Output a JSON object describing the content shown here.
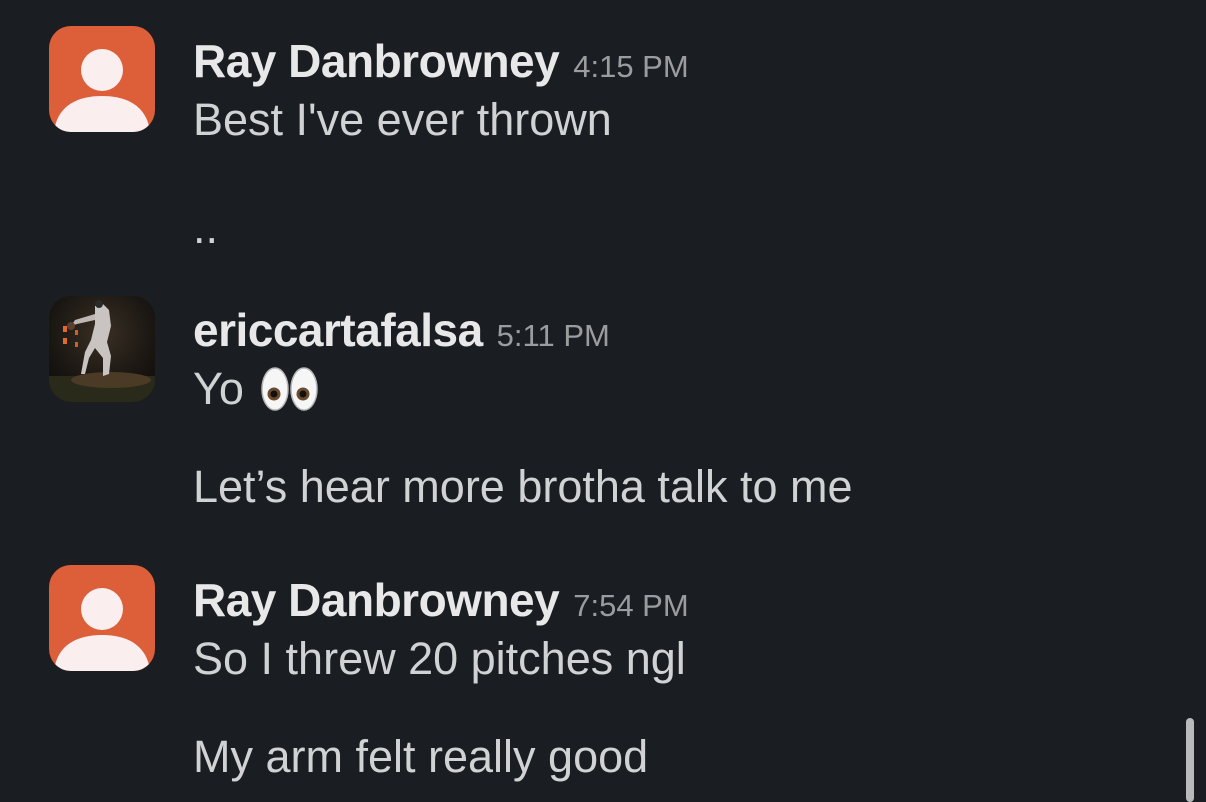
{
  "messages": [
    {
      "author": "Ray Danbrowney",
      "time": "4:15 PM",
      "avatar": "default-user-icon",
      "lines": [
        "Best I've ever thrown",
        ".."
      ]
    },
    {
      "author": "ericcartafalsa",
      "time": "5:11 PM",
      "avatar": "baseball-pitcher-photo",
      "lines": [
        "Yo",
        "Let’s hear more brotha talk to me"
      ],
      "emoji": "eyes-emoji"
    },
    {
      "author": "Ray Danbrowney",
      "time": "7:54 PM",
      "avatar": "default-user-icon",
      "lines": [
        "So I threw 20 pitches ngl",
        "My arm felt really good"
      ]
    }
  ],
  "colors": {
    "background": "#1a1d21",
    "default_avatar": "#dd5f3a",
    "text": "#d1d2d3",
    "timestamp": "#9b9c9e"
  }
}
